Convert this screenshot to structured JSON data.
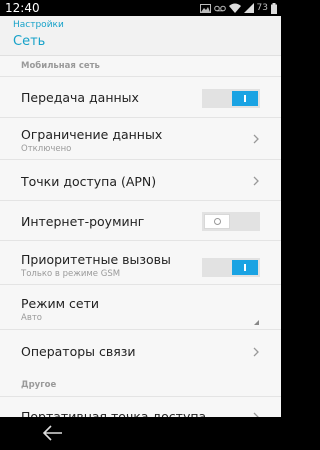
{
  "status_bar": {
    "time": "12:40",
    "battery_level": "73",
    "icons": [
      "image-icon",
      "voicemail-icon",
      "wifi-icon",
      "signal-icon",
      "battery-icon"
    ]
  },
  "header": {
    "breadcrumb": "Настройки",
    "title": "Сеть",
    "accent_color": "#17a2c9"
  },
  "sections": {
    "mobile": "Мобильная сеть",
    "other": "Другое"
  },
  "items": {
    "data_transfer": {
      "label": "Передача данных",
      "enabled": true
    },
    "data_limit": {
      "label": "Ограничение данных",
      "sub": "Отключено"
    },
    "apn": {
      "label": "Точки доступа (APN)"
    },
    "roaming": {
      "label": "Интернет-роуминг",
      "enabled": false
    },
    "priority_calls": {
      "label": "Приоритетные вызовы",
      "sub": "Только в режиме GSM",
      "enabled": true
    },
    "network_mode": {
      "label": "Режим сети",
      "sub": "Авто"
    },
    "operators": {
      "label": "Операторы связи"
    },
    "hotspot": {
      "label": "Портативная точка доступа"
    }
  },
  "switch_on_color": "#1aa3e3"
}
